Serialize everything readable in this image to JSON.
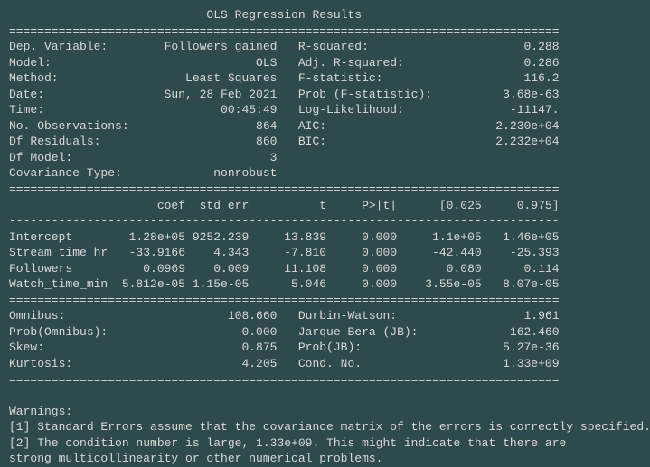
{
  "title": "OLS Regression Results",
  "header": {
    "left": [
      {
        "label": "Dep. Variable:",
        "value": "Followers_gained"
      },
      {
        "label": "Model:",
        "value": "OLS"
      },
      {
        "label": "Method:",
        "value": "Least Squares"
      },
      {
        "label": "Date:",
        "value": "Sun, 28 Feb 2021"
      },
      {
        "label": "Time:",
        "value": "00:45:49"
      },
      {
        "label": "No. Observations:",
        "value": "864"
      },
      {
        "label": "Df Residuals:",
        "value": "860"
      },
      {
        "label": "Df Model:",
        "value": "3"
      },
      {
        "label": "Covariance Type:",
        "value": "nonrobust"
      }
    ],
    "right": [
      {
        "label": "R-squared:",
        "value": "0.288"
      },
      {
        "label": "Adj. R-squared:",
        "value": "0.286"
      },
      {
        "label": "F-statistic:",
        "value": "116.2"
      },
      {
        "label": "Prob (F-statistic):",
        "value": "3.68e-63"
      },
      {
        "label": "Log-Likelihood:",
        "value": "-11147."
      },
      {
        "label": "AIC:",
        "value": "2.230e+04"
      },
      {
        "label": "BIC:",
        "value": "2.232e+04"
      }
    ]
  },
  "coef_table": {
    "columns": [
      "",
      "coef",
      "std err",
      "t",
      "P>|t|",
      "[0.025",
      "0.975]"
    ],
    "rows": [
      {
        "name": "Intercept",
        "coef": "1.28e+05",
        "stderr": "9252.239",
        "t": "13.839",
        "p": "0.000",
        "ci_low": "1.1e+05",
        "ci_high": "1.46e+05"
      },
      {
        "name": "Stream_time_hr",
        "coef": "-33.9166",
        "stderr": "4.343",
        "t": "-7.810",
        "p": "0.000",
        "ci_low": "-42.440",
        "ci_high": "-25.393"
      },
      {
        "name": "Followers",
        "coef": "0.0969",
        "stderr": "0.009",
        "t": "11.108",
        "p": "0.000",
        "ci_low": "0.080",
        "ci_high": "0.114"
      },
      {
        "name": "Watch_time_min",
        "coef": "5.812e-05",
        "stderr": "1.15e-05",
        "t": "5.046",
        "p": "0.000",
        "ci_low": "3.55e-05",
        "ci_high": "8.07e-05"
      }
    ]
  },
  "diagnostics": {
    "left": [
      {
        "label": "Omnibus:",
        "value": "108.660"
      },
      {
        "label": "Prob(Omnibus):",
        "value": "0.000"
      },
      {
        "label": "Skew:",
        "value": "0.875"
      },
      {
        "label": "Kurtosis:",
        "value": "4.205"
      }
    ],
    "right": [
      {
        "label": "Durbin-Watson:",
        "value": "1.961"
      },
      {
        "label": "Jarque-Bera (JB):",
        "value": "162.460"
      },
      {
        "label": "Prob(JB):",
        "value": "5.27e-36"
      },
      {
        "label": "Cond. No.",
        "value": "1.33e+09"
      }
    ]
  },
  "warnings": {
    "title": "Warnings:",
    "lines": [
      "[1] Standard Errors assume that the covariance matrix of the errors is correctly specified.",
      "[2] The condition number is large, 1.33e+09. This might indicate that there are",
      "strong multicollinearity or other numerical problems."
    ]
  }
}
